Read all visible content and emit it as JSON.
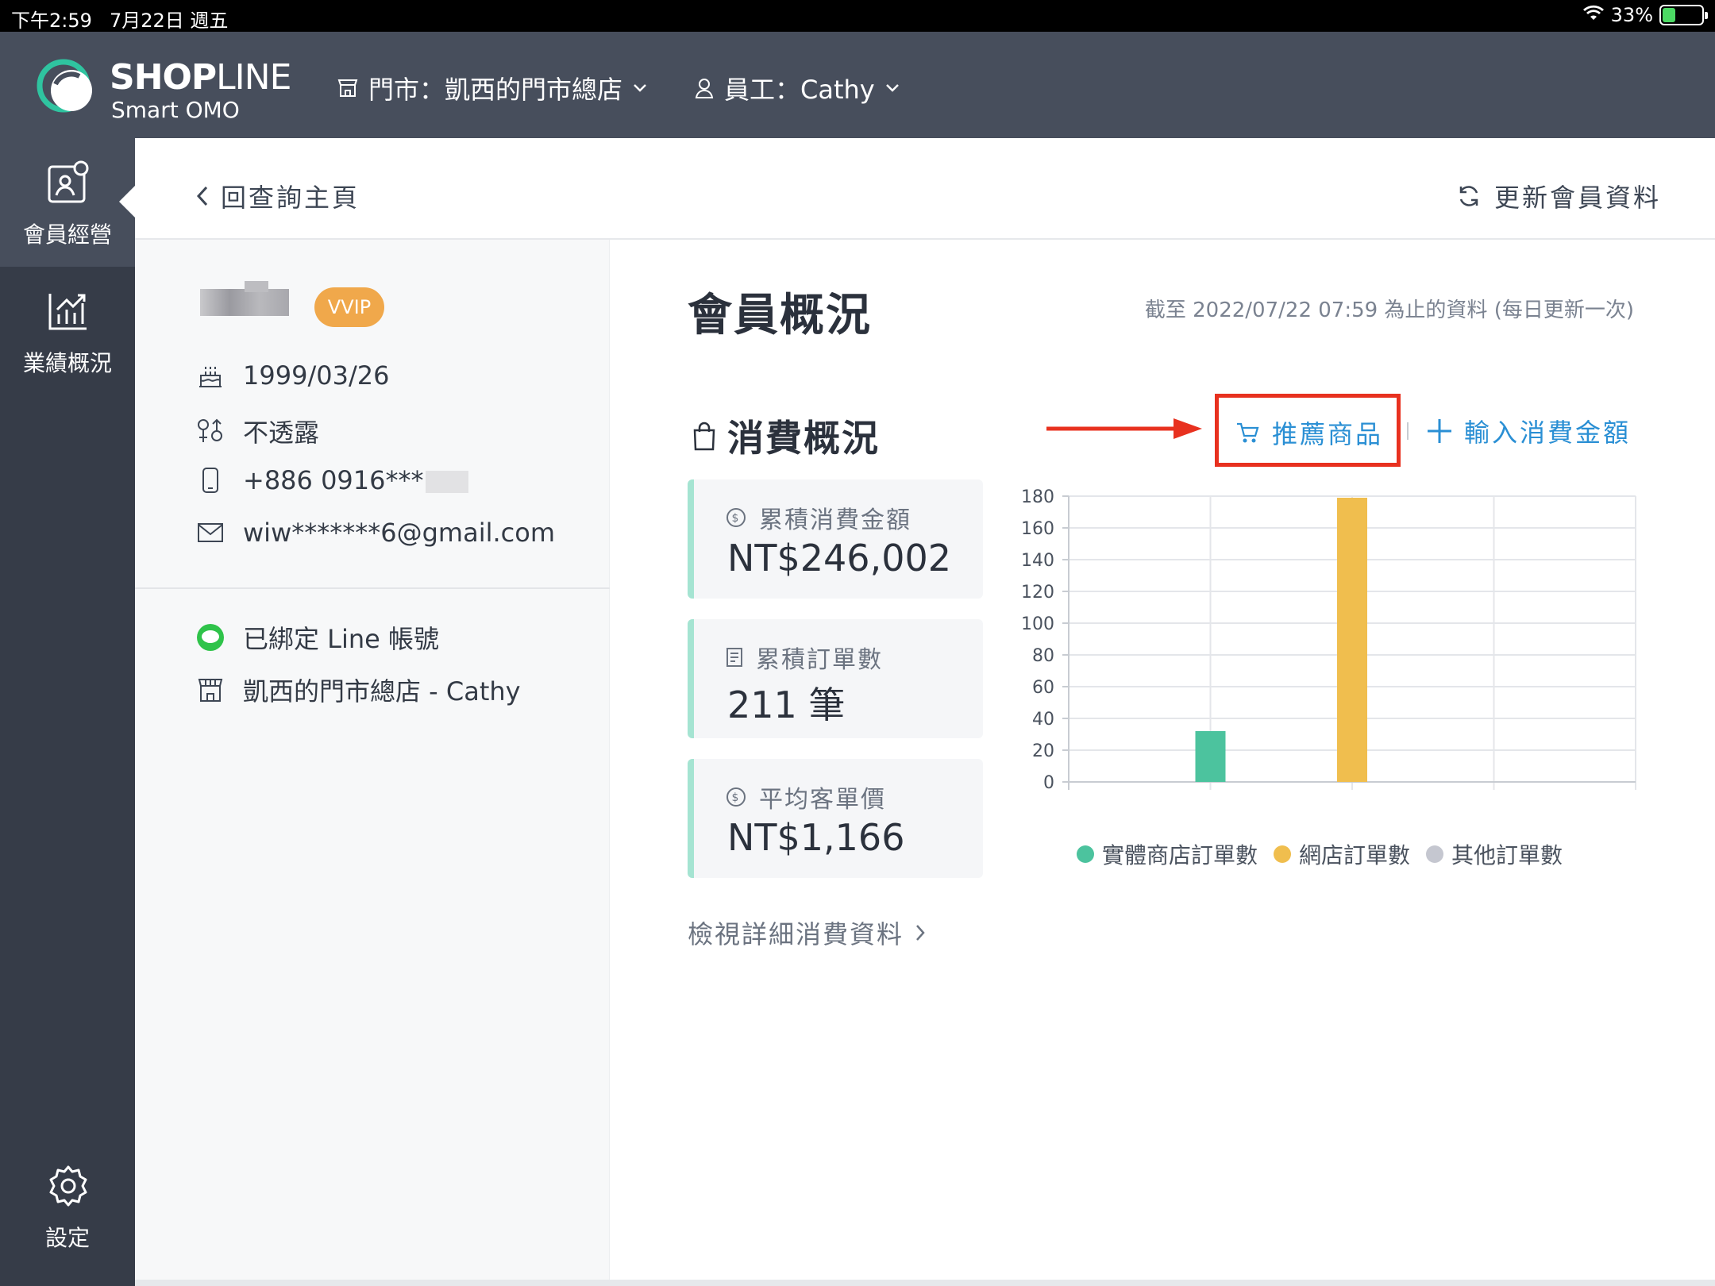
{
  "status_bar": {
    "time": "下午2:59",
    "date": "7月22日 週五",
    "battery": "33%",
    "battery_level": 0.33
  },
  "header": {
    "brand": "SHOPLINE",
    "brand_bold": "SHOP",
    "brand_thin": "LINE",
    "brand_sub": "Smart OMO",
    "store_selector": "門市：凱西的門市總店",
    "staff_selector": "員工：Cathy"
  },
  "sidebar": {
    "items": [
      {
        "label": "會員經營",
        "icon": "member-card-icon",
        "active": true
      },
      {
        "label": "業績概況",
        "icon": "chart-icon",
        "active": false
      },
      {
        "label": "設定",
        "icon": "gear-icon",
        "active": false
      }
    ]
  },
  "subheader": {
    "back_label": "回查詢主頁",
    "refresh_label": "更新會員資料"
  },
  "profile": {
    "badge": "VVIP",
    "birthday": "1999/03/26",
    "gender": "不透露",
    "phone": "+886 0916***",
    "email": "wiw*******6@gmail.com",
    "line_status": "已綁定 Line 帳號",
    "store": "凱西的門市總店 - Cathy"
  },
  "main": {
    "title": "會員概況",
    "updated_note": "截至 2022/07/22 07:59 為止的資料 (每日更新一次)",
    "section_title": "消費概況",
    "recommend_label": "推薦商品",
    "enter_amount_label": "輸入消費金額",
    "cards": [
      {
        "label": "累積消費金額",
        "value": "NT$246,002",
        "icon": "dollar-circle-icon"
      },
      {
        "label": "累積訂單數",
        "value": "211 筆",
        "icon": "receipt-icon"
      },
      {
        "label": "平均客單價",
        "value": "NT$1,166",
        "icon": "dollar-circle-icon"
      }
    ],
    "detail_link": "檢視詳細消費資料"
  },
  "colors": {
    "accent": "#2a8fd4",
    "store": "#4cc39e",
    "online": "#f0be4e",
    "other": "#c5c7d0",
    "highlight": "#e8311f"
  },
  "chart_data": {
    "type": "bar",
    "categories": [
      "實體商店訂單數",
      "網店訂單數",
      "其他訂單數"
    ],
    "values": [
      32,
      179,
      0
    ],
    "colors": [
      "#4cc39e",
      "#f0be4e",
      "#c5c7d0"
    ],
    "ylim": [
      0,
      180
    ],
    "yticks": [
      0,
      20,
      40,
      60,
      80,
      100,
      120,
      140,
      160,
      180
    ],
    "legend": [
      "實體商店訂單數",
      "網店訂單數",
      "其他訂單數"
    ],
    "legend_position": "bottom",
    "grid": true
  }
}
